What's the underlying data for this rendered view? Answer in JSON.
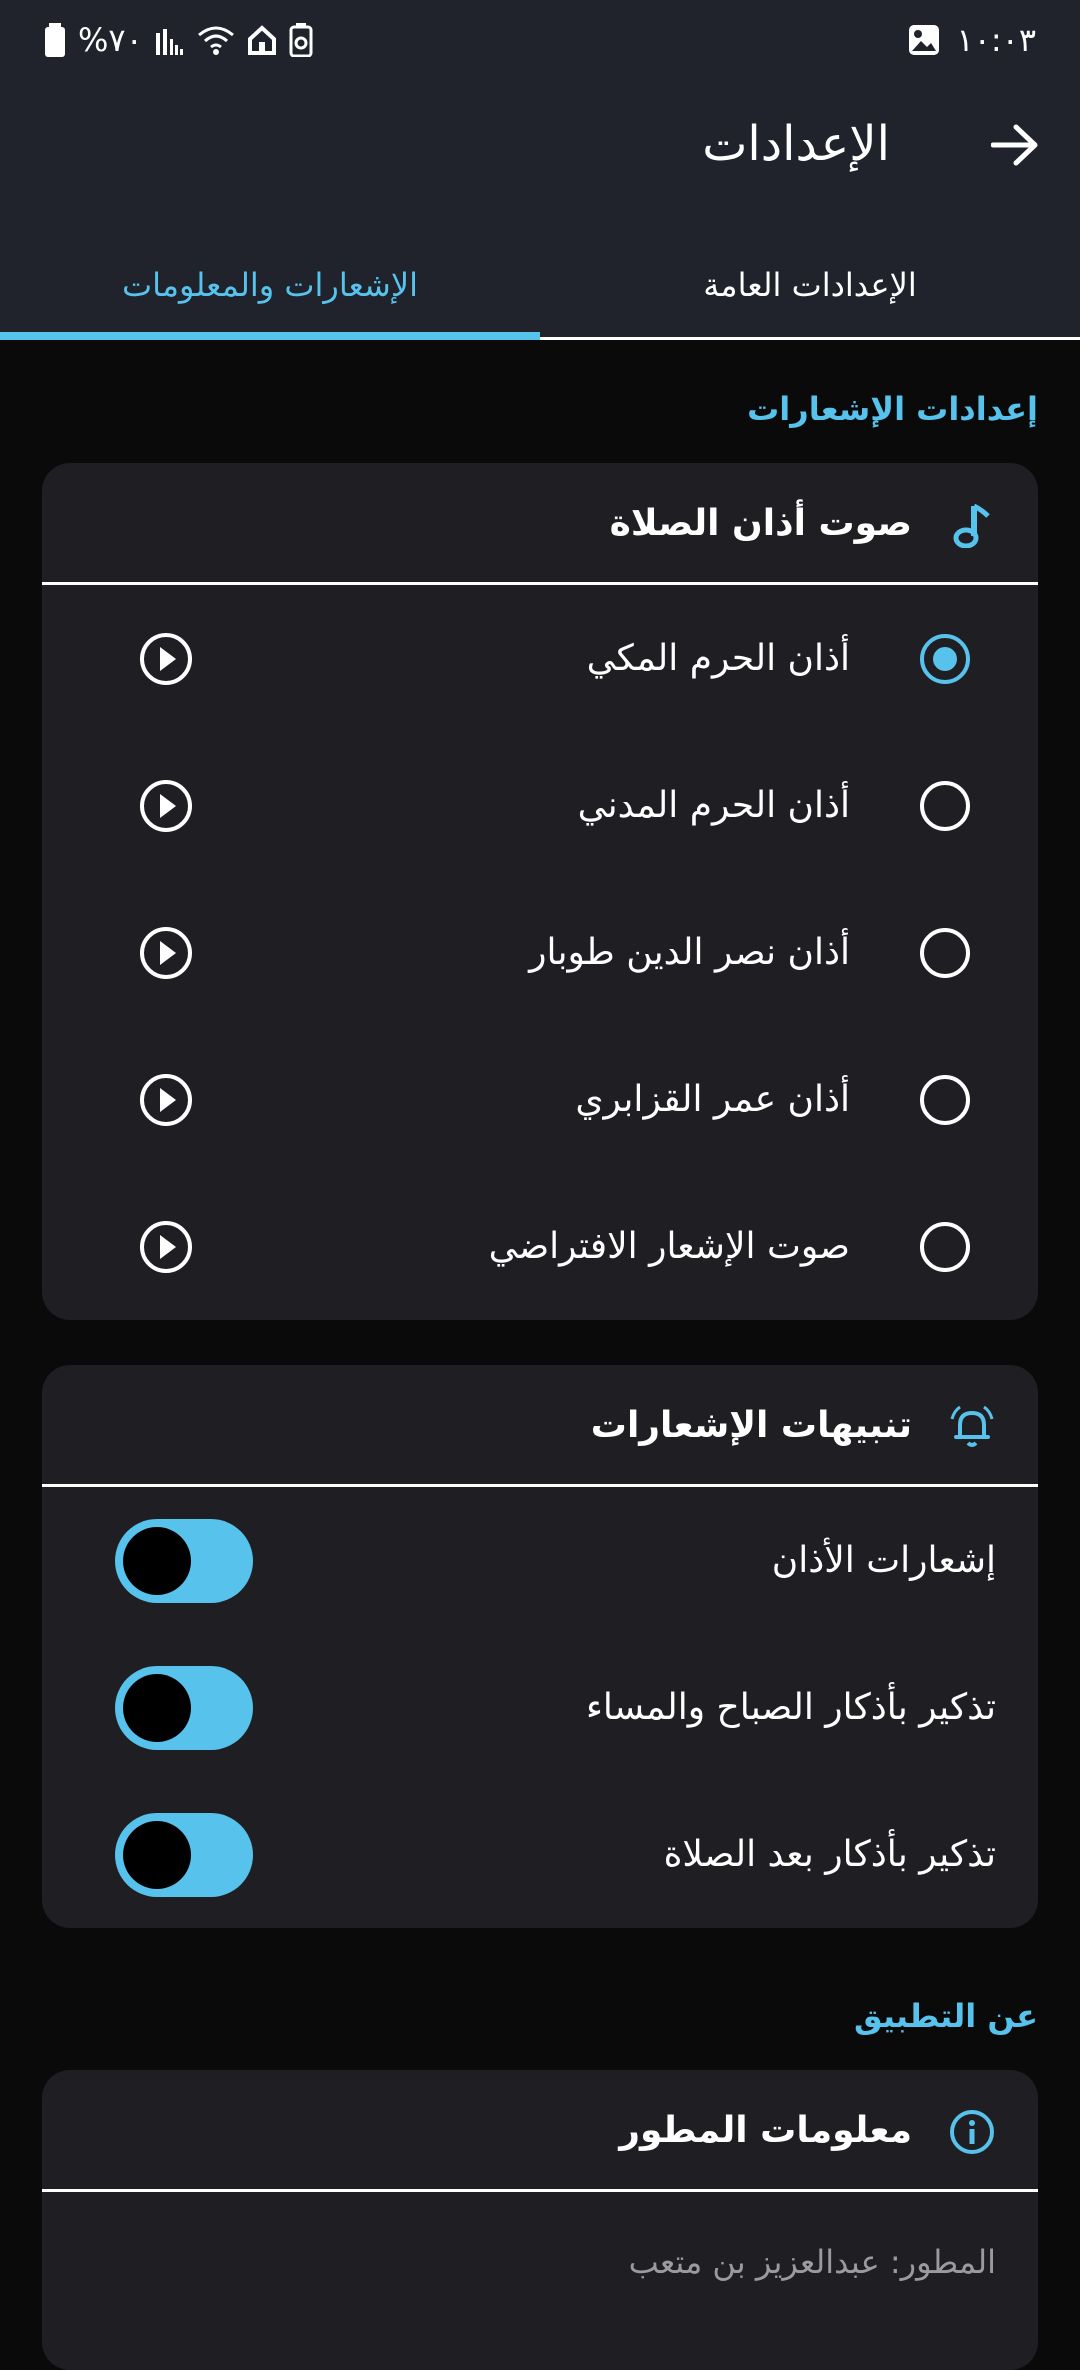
{
  "status_bar": {
    "time": "١٠:٠٣",
    "battery": "%٧٠"
  },
  "header": {
    "title": "الإعدادات"
  },
  "tabs": [
    {
      "label": "الإعدادات العامة",
      "active": false
    },
    {
      "label": "الإشعارات والمعلومات",
      "active": true
    }
  ],
  "notifications_section": {
    "header": "إعدادات الإشعارات",
    "adhan_card": {
      "title": "صوت أذان الصلاة",
      "icon": "music-note-icon",
      "options": [
        {
          "label": "أذان الحرم المكي",
          "selected": true
        },
        {
          "label": "أذان الحرم المدني",
          "selected": false
        },
        {
          "label": "أذان نصر الدين طوبار",
          "selected": false
        },
        {
          "label": "أذان عمر القزابري",
          "selected": false
        },
        {
          "label": "صوت الإشعار الافتراضي",
          "selected": false
        }
      ]
    },
    "alerts_card": {
      "title": "تنبيهات الإشعارات",
      "icon": "bell-icon",
      "toggles": [
        {
          "label": "إشعارات الأذان",
          "on": true
        },
        {
          "label": "تذكير بأذكار الصباح والمساء",
          "on": true
        },
        {
          "label": "تذكير بأذكار بعد الصلاة",
          "on": true
        }
      ]
    }
  },
  "about_section": {
    "header": "عن التطبيق",
    "developer_card": {
      "title": "معلومات المطور",
      "icon": "info-icon",
      "developer": "المطور: عبدالعزيز بن متعب"
    }
  },
  "colors": {
    "accent": "#57c2ec",
    "bar_bg": "#20232c",
    "card_bg": "#1f1f23",
    "page_bg": "#0a0a0b"
  }
}
